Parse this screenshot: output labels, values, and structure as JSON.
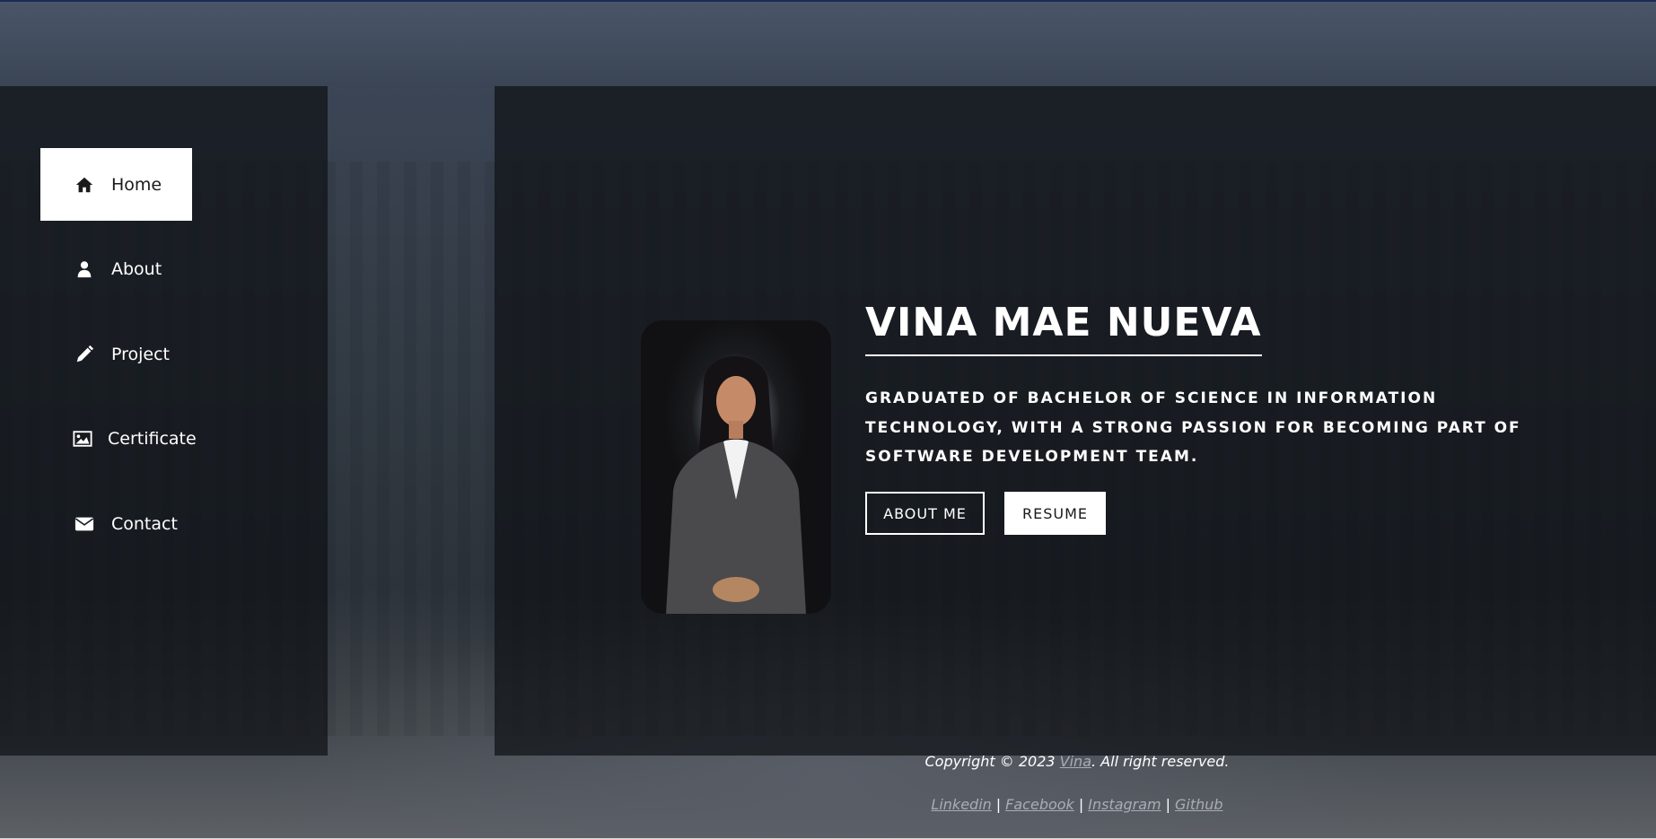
{
  "nav": {
    "items": [
      {
        "label": "Home",
        "icon": "home-icon",
        "active": true
      },
      {
        "label": "About",
        "icon": "user-icon",
        "active": false
      },
      {
        "label": "Project",
        "icon": "pencil-icon",
        "active": false
      },
      {
        "label": "Certificate",
        "icon": "image-icon",
        "active": false
      },
      {
        "label": "Contact",
        "icon": "envelope-icon",
        "active": false
      }
    ]
  },
  "hero": {
    "name": "VINA MAE NUEVA",
    "tagline": "GRADUATED OF BACHELOR OF SCIENCE IN INFORMATION TECHNOLOGY, WITH A STRONG PASSION FOR BECOMING PART OF SOFTWARE DEVELOPMENT TEAM.",
    "about_button": "ABOUT ME",
    "resume_button": "RESUME"
  },
  "footer": {
    "copyright_prefix": "Copyright © 2023",
    "copyright_link": "Vina",
    "copyright_suffix": ". All right reserved.",
    "socials": [
      "Linkedin",
      "Facebook",
      "Instagram",
      "Github"
    ],
    "separator": "|"
  },
  "colors": {
    "panel": "#0f1216",
    "accent": "#ffffff",
    "link": "#a9adb3"
  }
}
